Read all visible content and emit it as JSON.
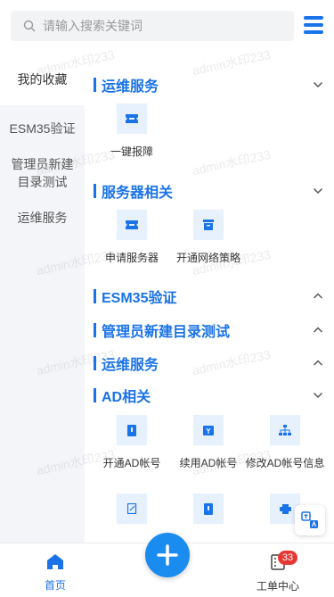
{
  "search": {
    "placeholder": "请输入搜索关键词"
  },
  "sidebar": {
    "items": [
      {
        "label": "我的收藏"
      },
      {
        "label": "ESM35验证"
      },
      {
        "label": "管理员新建目录测试"
      },
      {
        "label": "运维服务"
      }
    ]
  },
  "sections": [
    {
      "title": "运维服务",
      "expanded": true,
      "items": [
        {
          "label": "一键报障"
        }
      ]
    },
    {
      "title": "服务器相关",
      "expanded": true,
      "items": [
        {
          "label": "申请服务器"
        },
        {
          "label": "开通网络策略"
        }
      ]
    },
    {
      "title": "ESM35验证",
      "expanded": false,
      "items": []
    },
    {
      "title": "管理员新建目录测试",
      "expanded": false,
      "items": []
    },
    {
      "title": "运维服务",
      "expanded": false,
      "items": []
    },
    {
      "title": "AD相关",
      "expanded": true,
      "items": [
        {
          "label": "开通AD帐号"
        },
        {
          "label": "续用AD帐号"
        },
        {
          "label": "修改AD帐号信息"
        }
      ]
    }
  ],
  "watermark": "admin水印233",
  "bottom_nav": {
    "home_label": "首页",
    "orders_label": "工单中心",
    "orders_badge": "33"
  },
  "colors": {
    "accent": "#1a73e8",
    "tile_bg": "#e6f1fd",
    "sidebar_bg": "#f3f5f8",
    "badge": "#e53935"
  },
  "icons": [
    "search-icon",
    "menu-icon",
    "ticket-icon",
    "server-icon",
    "network-icon",
    "ad-account-icon",
    "chevron-down-icon",
    "chevron-up-icon",
    "home-icon",
    "work-order-icon",
    "plus-icon",
    "translate-icon"
  ]
}
